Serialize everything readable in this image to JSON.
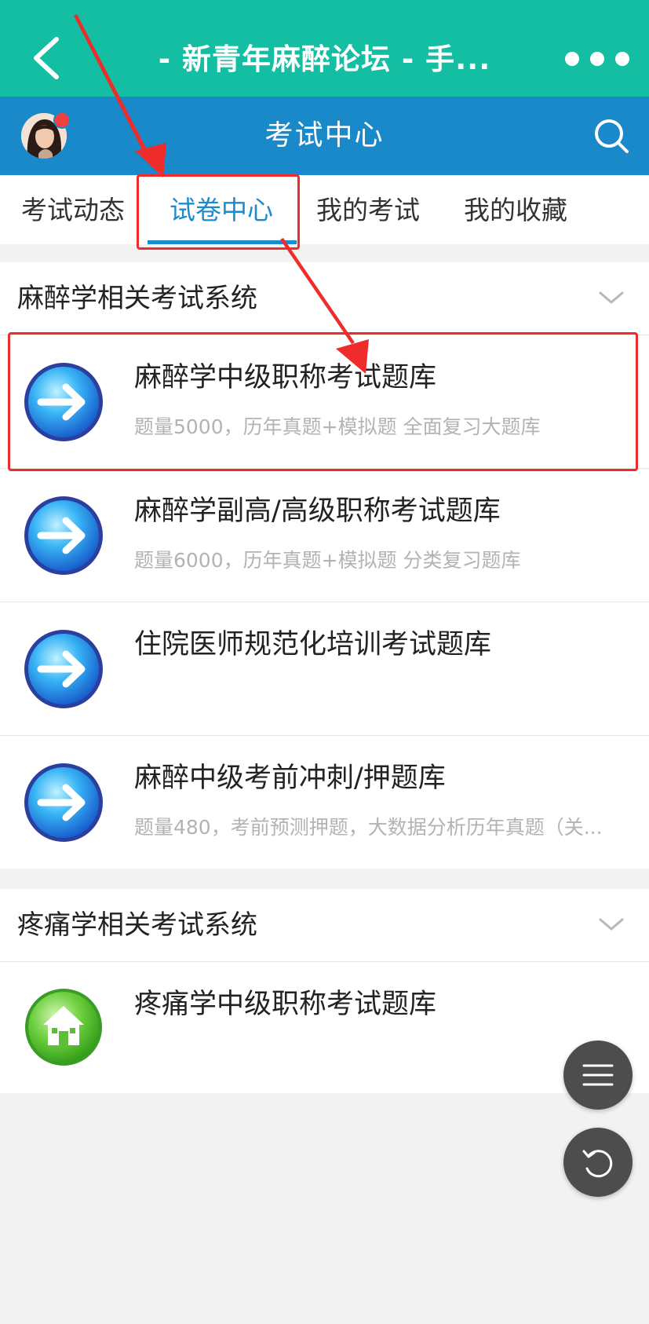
{
  "header": {
    "title": "- 新青年麻醉论坛 - 手...",
    "section_title": "考试中心"
  },
  "tabs": [
    {
      "label": "考试动态",
      "active": false
    },
    {
      "label": "试卷中心",
      "active": true
    },
    {
      "label": "我的考试",
      "active": false
    },
    {
      "label": "我的收藏",
      "active": false
    }
  ],
  "sections": [
    {
      "title": "麻醉学相关考试系统",
      "items": [
        {
          "title": "麻醉学中级职称考试题库",
          "desc": "题量5000，历年真题+模拟题 全面复习大题库",
          "icon": "arrow-circle-icon"
        },
        {
          "title": "麻醉学副高/高级职称考试题库",
          "desc": "题量6000，历年真题+模拟题 分类复习题库",
          "icon": "arrow-circle-icon"
        },
        {
          "title": "住院医师规范化培训考试题库",
          "desc": "",
          "icon": "arrow-circle-icon"
        },
        {
          "title": "麻醉中级考前冲刺/押题库",
          "desc": "题量480，考前预测押题，大数据分析历年真题（关...",
          "icon": "arrow-circle-icon"
        }
      ]
    },
    {
      "title": "疼痛学相关考试系统",
      "items": [
        {
          "title": "疼痛学中级职称考试题库",
          "desc": "",
          "icon": "home-circle-icon"
        }
      ]
    }
  ],
  "colors": {
    "header_teal": "#13bea2",
    "header_blue": "#1a89c9",
    "tab_active": "#1b8ad1",
    "annotation_red": "#ef2c2c"
  }
}
